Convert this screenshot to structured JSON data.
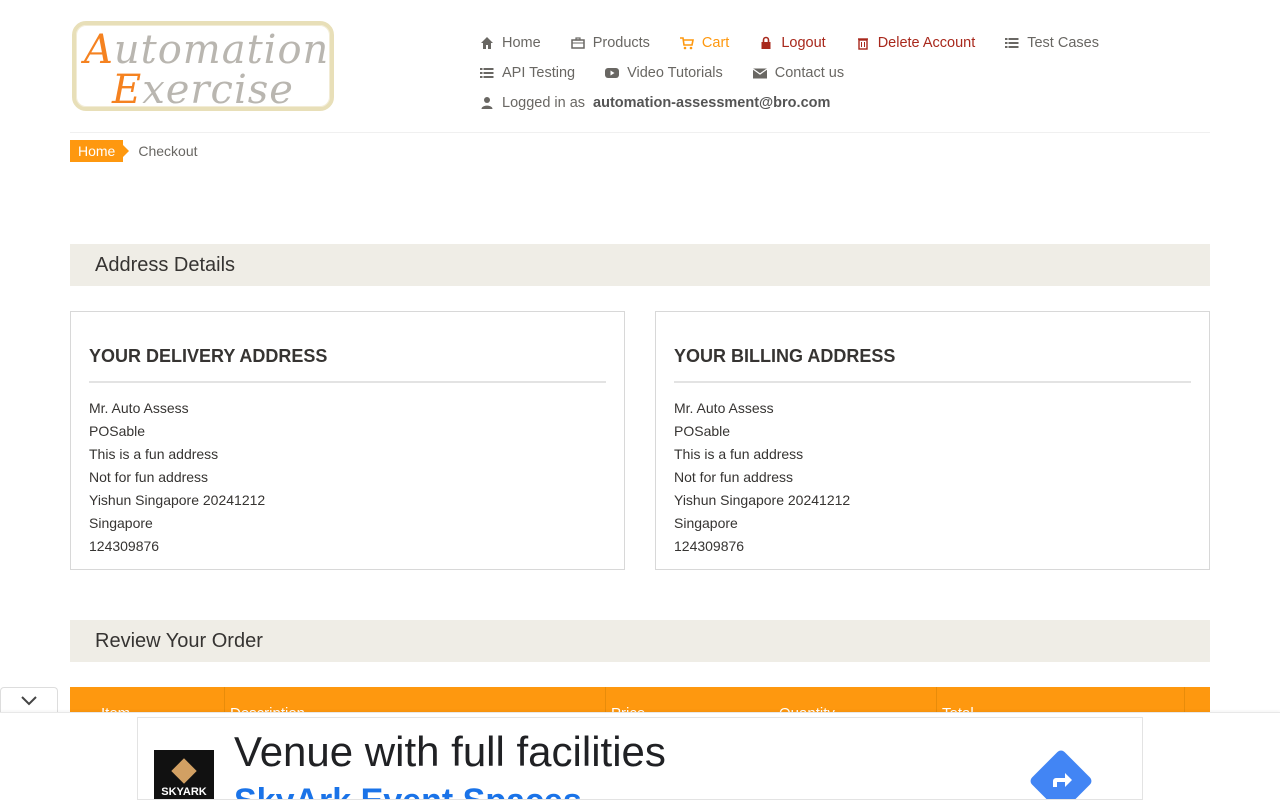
{
  "logo": {
    "line1_cap": "A",
    "line1_rest": "utomation",
    "line2_cap": "E",
    "line2_rest": "xercise"
  },
  "nav": {
    "row1": [
      {
        "label": "Home",
        "icon": "home-icon"
      },
      {
        "label": "Products",
        "icon": "briefcase-icon"
      },
      {
        "label": "Cart",
        "icon": "cart-icon"
      },
      {
        "label": "Logout",
        "icon": "lock-icon"
      },
      {
        "label": "Delete Account",
        "icon": "trash-icon"
      },
      {
        "label": "Test Cases",
        "icon": "list-icon"
      }
    ],
    "row2": [
      {
        "label": "API Testing",
        "icon": "list-icon"
      },
      {
        "label": "Video Tutorials",
        "icon": "youtube-icon"
      },
      {
        "label": "Contact us",
        "icon": "envelope-icon"
      }
    ],
    "logged_prefix": "Logged in as",
    "logged_user": "automation-assessment@bro.com"
  },
  "breadcrumb": {
    "home": "Home",
    "current": "Checkout"
  },
  "sections": {
    "address": "Address Details",
    "review": "Review Your Order"
  },
  "delivery": {
    "title": "YOUR DELIVERY ADDRESS",
    "lines": [
      "Mr. Auto Assess",
      "POSable",
      "This is a fun address",
      "Not for fun address",
      "Yishun Singapore 20241212",
      "Singapore",
      "124309876"
    ]
  },
  "billing": {
    "title": "YOUR BILLING ADDRESS",
    "lines": [
      "Mr. Auto Assess",
      "POSable",
      "This is a fun address",
      "Not for fun address",
      "Yishun Singapore 20241212",
      "Singapore",
      "124309876"
    ]
  },
  "table": {
    "headers": [
      "Item",
      "Description",
      "Price",
      "Quantity",
      "Total"
    ]
  },
  "ad": {
    "brand": "SKYARK",
    "title": "Venue with full facilities",
    "subtitle": "SkyArk Event Spaces"
  },
  "colors": {
    "accent": "#fe980f",
    "danger": "#a8281c",
    "section_bg": "#efede6"
  }
}
